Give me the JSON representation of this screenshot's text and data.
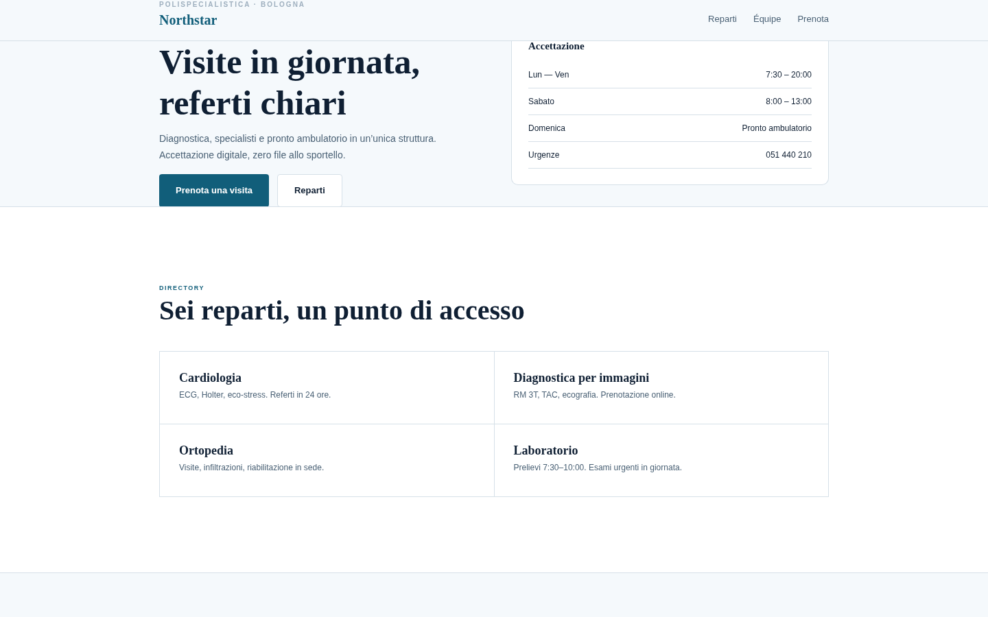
{
  "header": {
    "eyebrow": "POLISPECIALISTICA · BOLOGNA",
    "logo": "Northstar",
    "nav": [
      "Reparti",
      "Équipe",
      "Prenota"
    ]
  },
  "hero": {
    "title_lines": [
      "Visite in giornata,",
      "referti chiari"
    ],
    "lead_lines": [
      "Diagnostica, specialisti e pronto ambulatorio in un’unica struttura.",
      "Accettazione digitale, zero file allo sportello."
    ],
    "buttons": [
      {
        "label": "Prenota una visita",
        "kind": "primary"
      },
      {
        "label": "Reparti",
        "kind": "secondary"
      }
    ]
  },
  "hours_card": {
    "title": "Accettazione",
    "rows": [
      {
        "day": "Lun — Ven",
        "time": "7:30 – 20:00"
      },
      {
        "day": "Sabato",
        "time": "8:00 – 13:00"
      },
      {
        "day": "Domenica",
        "time": "Pronto ambulatorio"
      },
      {
        "day": "Urgenze",
        "time": "051 440 210"
      }
    ]
  },
  "directory": {
    "eyebrow": "DIRECTORY",
    "title": "Sei reparti, un punto di accesso",
    "departments": [
      {
        "name": "Cardiologia",
        "description": "ECG, Holter, eco-stress. Referti in 24 ore."
      },
      {
        "name": "Diagnostica per immagini",
        "description": "RM 3T, TAC, ecografia. Prenotazione online."
      },
      {
        "name": "Ortopedia",
        "description": "Visite, infiltrazioni, riabilitazione in sede."
      },
      {
        "name": "Laboratorio",
        "description": "Prelievi 7:30–10:00. Esami urgenti in giornata."
      }
    ]
  }
}
